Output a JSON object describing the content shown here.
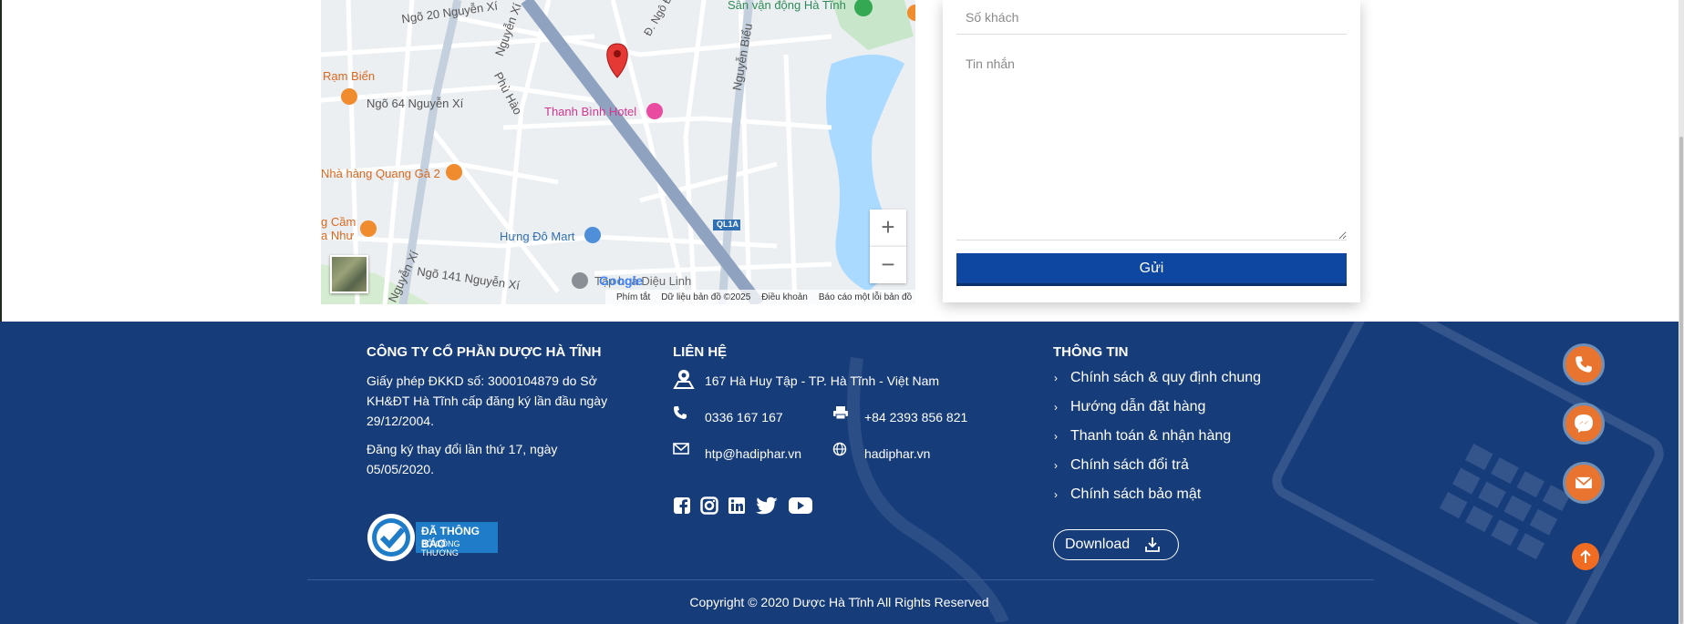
{
  "map": {
    "labels": {
      "ngo20": "Ngõ 20 Nguyễn Xí",
      "nguyenxi_a": "Nguyễn Xí",
      "dngo": "Đ. Ngô Đ",
      "sanvandong": "Sân vận động Hà Tĩnh",
      "nguyenbieu": "Nguyễn Biểu",
      "rambien": "Rạm Biển",
      "ngo64": "Ngõ 64 Nguyễn Xí",
      "phuhao": "Phù Hào",
      "thanhbinh": "Thanh Bình Hotel",
      "quangga": "Nhà hàng Quang Gà 2",
      "camnhu": "g Cầm\na Như",
      "hungdo": "Hưng Đô Mart",
      "ql1a": "QL1A",
      "nguyenxi_b": "Nguyễn Xí",
      "ngo141": "Ngõ 141 Nguyễn Xí",
      "dieulinh": "Tạp hoá Diệu Linh",
      "google": "Google"
    },
    "footer": [
      "Phím tắt",
      "Dữ liệu bản đồ ©2025",
      "Điều khoản",
      "Báo cáo một lỗi bản đồ"
    ],
    "zoom_in": "+",
    "zoom_out": "−"
  },
  "form": {
    "guests_placeholder": "Số khách",
    "message_placeholder": "Tin nhắn",
    "submit_label": "Gửi"
  },
  "footer": {
    "company": {
      "title": "CÔNG TY CỔ PHẦN DƯỢC HÀ TĨNH",
      "license_1": "Giấy phép ĐKKD số: 3000104879 do Sở",
      "license_2": "KH&ĐT Hà Tĩnh cấp đăng ký lần đầu ngày",
      "license_3": "29/12/2004.",
      "change_1": "Đăng ký thay đổi lần thứ 17, ngày",
      "change_2": "05/05/2020.",
      "badge_main": "ĐÃ THÔNG BÁO",
      "badge_sub": "BỘ CÔNG THƯƠNG"
    },
    "contact": {
      "title": "LIÊN HỆ",
      "address": "167 Hà Huy Tập - TP. Hà Tĩnh - Việt Nam",
      "phone": "0336 167 167",
      "fax": "+84 2393 856 821",
      "email": "htp@hadiphar.vn",
      "website": "hadiphar.vn"
    },
    "info": {
      "title": "THÔNG TIN",
      "links": [
        "Chính sách & quy định chung",
        "Hướng dẫn đặt hàng",
        "Thanh toán & nhận hàng",
        "Chính sách đổi trả",
        "Chính sách bảo mật"
      ],
      "download": "Download"
    },
    "copyright": "Copyright © 2020 Dược Hà Tĩnh All Rights Reserved"
  },
  "icons": [
    "map-pin-icon",
    "phone-icon",
    "printer-icon",
    "mail-icon",
    "globe-icon",
    "facebook-icon",
    "instagram-icon",
    "linkedin-icon",
    "twitter-icon",
    "youtube-icon",
    "chevron-right-icon",
    "download-icon",
    "messenger-icon",
    "arrow-up-icon"
  ],
  "colors": {
    "footer_bg": "#163c7a",
    "button": "#0d47a1",
    "accent": "#e8742f"
  }
}
